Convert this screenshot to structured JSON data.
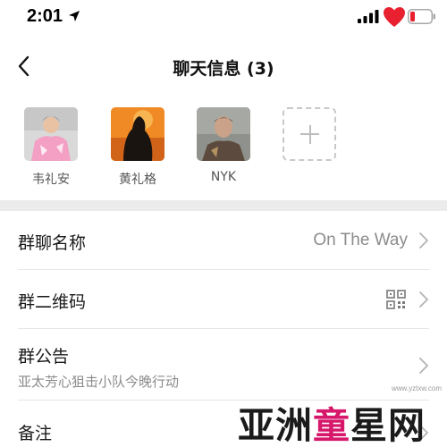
{
  "status_bar": {
    "time": "2:01",
    "icons": [
      "location-arrow-icon",
      "signal-bars-icon",
      "heart-icon",
      "battery-low-icon"
    ],
    "colors": {
      "heart": "#e8202f",
      "battery_level": "#e8202f"
    }
  },
  "nav": {
    "back_icon": "chevron-left-icon",
    "title": "聊天信息 (3)"
  },
  "members": [
    {
      "name": "韦礼安"
    },
    {
      "name": "黄礼格"
    },
    {
      "name": "NYK"
    }
  ],
  "add_member_icon": "plus-icon",
  "rows": {
    "group_name": {
      "label": "群聊名称",
      "value": "On The Way"
    },
    "group_qr": {
      "label": "群二维码",
      "icon": "qr-code-icon"
    },
    "announcement": {
      "label": "群公告",
      "text": "亚太芳心狙击小队今晚行动"
    },
    "note": {
      "label": "备注"
    }
  },
  "watermark": {
    "prefix": "亚洲",
    "highlight": "童",
    "suffix": "星网",
    "url": "www.yztxw.com",
    "colors": {
      "highlight": "#d6176a"
    }
  }
}
